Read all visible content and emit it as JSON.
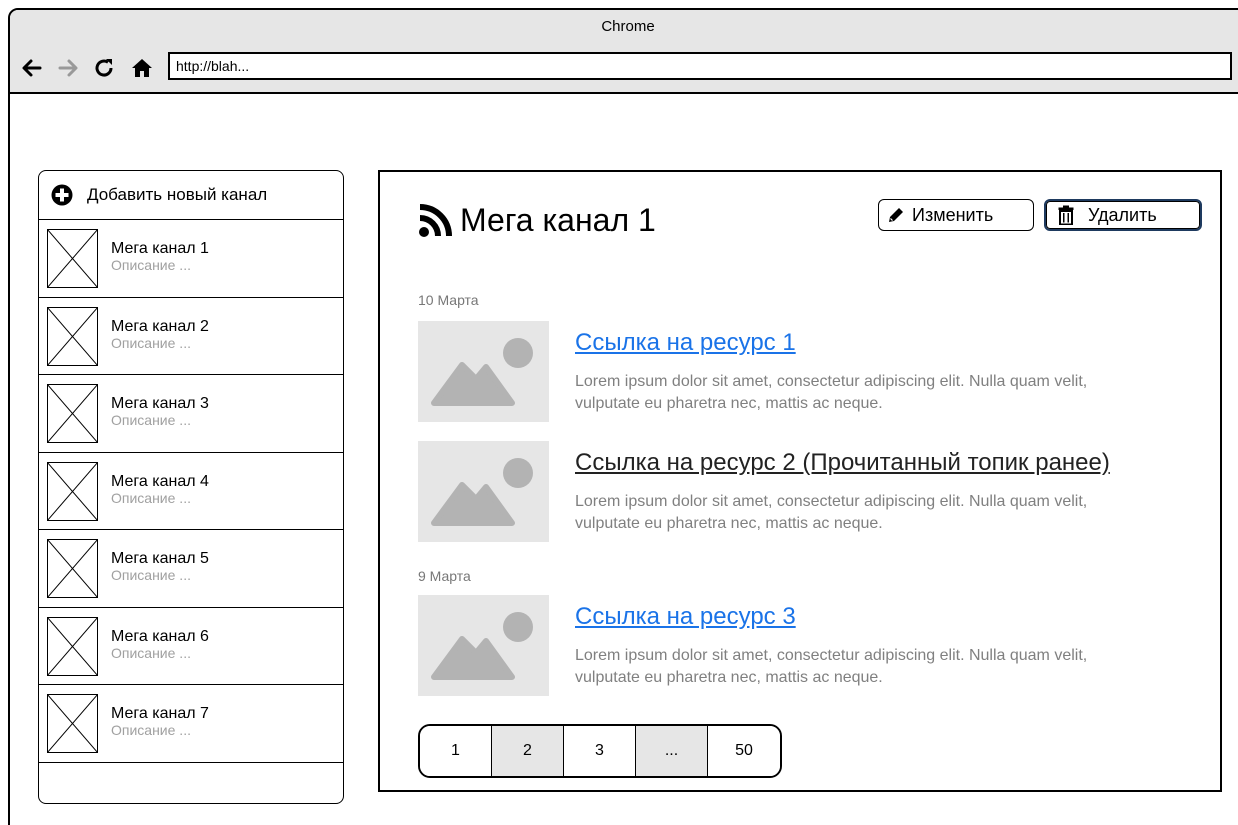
{
  "window": {
    "title": "Chrome",
    "address": "http://blah..."
  },
  "sidebar": {
    "add_label": "Добавить новый канал",
    "channels": [
      {
        "name": "Мега канал 1",
        "desc": "Описание ..."
      },
      {
        "name": "Мега канал 2",
        "desc": "Описание ..."
      },
      {
        "name": "Мега канал 3",
        "desc": "Описание ..."
      },
      {
        "name": "Мега канал 4",
        "desc": "Описание ..."
      },
      {
        "name": "Мега канал 5",
        "desc": "Описание ..."
      },
      {
        "name": "Мега канал 6",
        "desc": "Описание ..."
      },
      {
        "name": "Мега канал 7",
        "desc": "Описание ..."
      }
    ]
  },
  "main": {
    "title": "Мега канал 1",
    "edit_label": "Изменить",
    "delete_label": "Удалить",
    "groups": [
      {
        "date": "10 Марта"
      },
      {
        "date": "9 Марта"
      }
    ],
    "items": [
      {
        "link": "Ссылка на ресурс 1",
        "desc": "Lorem ipsum dolor sit amet, consectetur adipiscing elit. Nulla quam velit, vulputate eu pharetra nec, mattis ac neque."
      },
      {
        "link": "Ссылка на ресурс 2 (Прочитанный топик ранее)",
        "desc": "Lorem ipsum dolor sit amet, consectetur adipiscing elit. Nulla quam velit, vulputate eu pharetra nec, mattis ac neque."
      },
      {
        "link": "Ссылка на ресурс 3",
        "desc": "Lorem ipsum dolor sit amet, consectetur adipiscing elit. Nulla quam velit, vulputate eu pharetra nec, mattis ac neque."
      }
    ],
    "pagination": [
      "1",
      "2",
      "3",
      "...",
      "50"
    ]
  },
  "icons": {
    "add": "plus-circle-icon",
    "rss": "rss-icon",
    "edit": "pencil-icon",
    "delete": "trash-icon",
    "image": "image-placeholder-icon"
  },
  "colors": {
    "link": "#1a73e8",
    "visited_link": "#222222",
    "muted_text": "#808080",
    "placeholder_bg": "#e6e6e6",
    "chrome_bg": "#e6e6e6"
  }
}
